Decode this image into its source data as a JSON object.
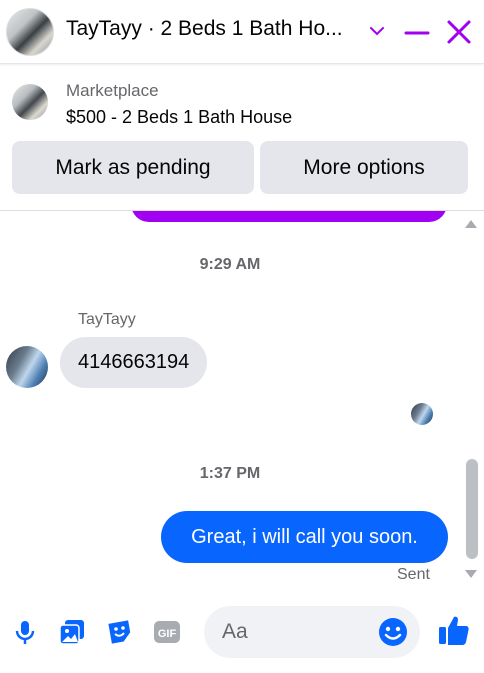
{
  "header": {
    "title": "TayTayy · 2 Beds 1 Bath Ho...",
    "icons": [
      "chevron-down-icon",
      "minimize-icon",
      "close-icon"
    ]
  },
  "marketplace": {
    "label": "Marketplace",
    "listing": "$500 - 2 Beds 1 Bath House"
  },
  "actions": {
    "mark_pending": "Mark as pending",
    "more_options": "More options"
  },
  "thread": {
    "timestamp_1": "9:29 AM",
    "sender_name": "TayTayy",
    "incoming_message": "4146663194",
    "timestamp_2": "1:37 PM",
    "outgoing_message": "Great, i will call you soon.",
    "status": "Sent"
  },
  "composer": {
    "placeholder": "Aa",
    "icons": [
      "microphone-icon",
      "photo-icon",
      "sticker-icon",
      "gif-icon",
      "emoji-icon",
      "thumbs-up-icon"
    ]
  },
  "colors": {
    "accent": "#a100f2",
    "outgoing_bubble": "#0866ff",
    "incoming_bubble": "#e4e6eb",
    "icon_blue": "#0866ff"
  }
}
